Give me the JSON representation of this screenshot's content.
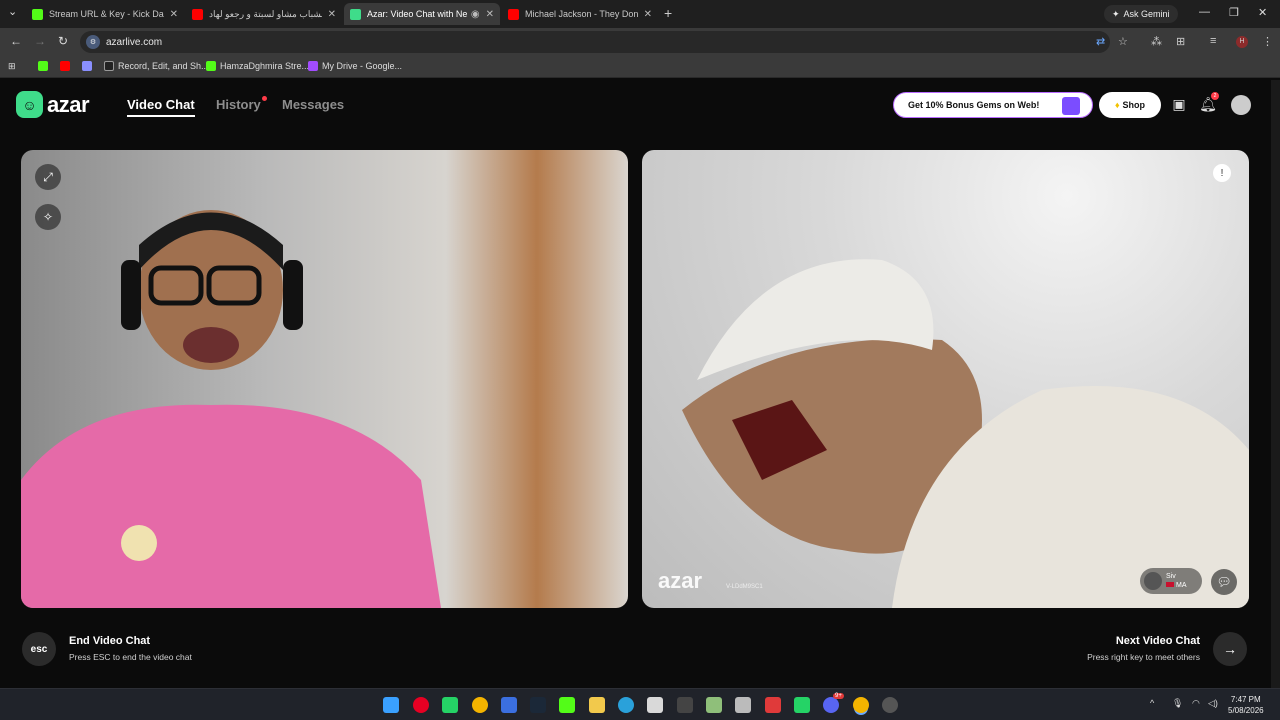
{
  "browser": {
    "tabs": [
      {
        "title": "Stream URL & Key - Kick Dashb",
        "active": false,
        "favicon_color": "#53fc18"
      },
      {
        "title": "الشباب مشاو لسبتة و رجعو لهاد |",
        "active": false,
        "favicon_color": "#ff0000"
      },
      {
        "title": "Azar: Video Chat with New",
        "active": true,
        "favicon_color": "#3fdc8a"
      },
      {
        "title": "Michael Jackson - They Don't C",
        "active": false,
        "favicon_color": "#ff0000"
      }
    ],
    "ask_gemini": "Ask Gemini",
    "url": "azarlive.com",
    "bookmarks": [
      {
        "label": "",
        "color": "#53fc18"
      },
      {
        "label": "",
        "color": "#ff0000"
      },
      {
        "label": "",
        "color": "#8a8fff"
      },
      {
        "label": "Record, Edit, and Sh...",
        "color": "#222"
      },
      {
        "label": "HamzaDghmira Stre...",
        "color": "#53fc18"
      },
      {
        "label": "My Drive - Google...",
        "color": "#a24cff"
      }
    ]
  },
  "azar": {
    "logo_text": "azar",
    "nav": {
      "video_chat": "Video Chat",
      "history": "History",
      "messages": "Messages"
    },
    "promo": "Get 10% Bonus Gems on Web!",
    "shop": "Shop",
    "notification_count": "2",
    "watermark": "azar",
    "watermark_id": "V-LDdM9SC1",
    "peer": {
      "name": "Siv",
      "country": "MA"
    },
    "footer": {
      "esc_key": "esc",
      "end_title": "End Video Chat",
      "end_sub": "Press ESC to end the video chat",
      "next_title": "Next Video Chat",
      "next_sub": "Press right key to meet others"
    }
  },
  "taskbar": {
    "time": "7:47 PM",
    "date": "5/08/2026",
    "chat_badge": "9+"
  },
  "colors": {
    "accent": "#3fdc8a",
    "alert": "#ff3b48",
    "promo_border": "#b96cff"
  }
}
